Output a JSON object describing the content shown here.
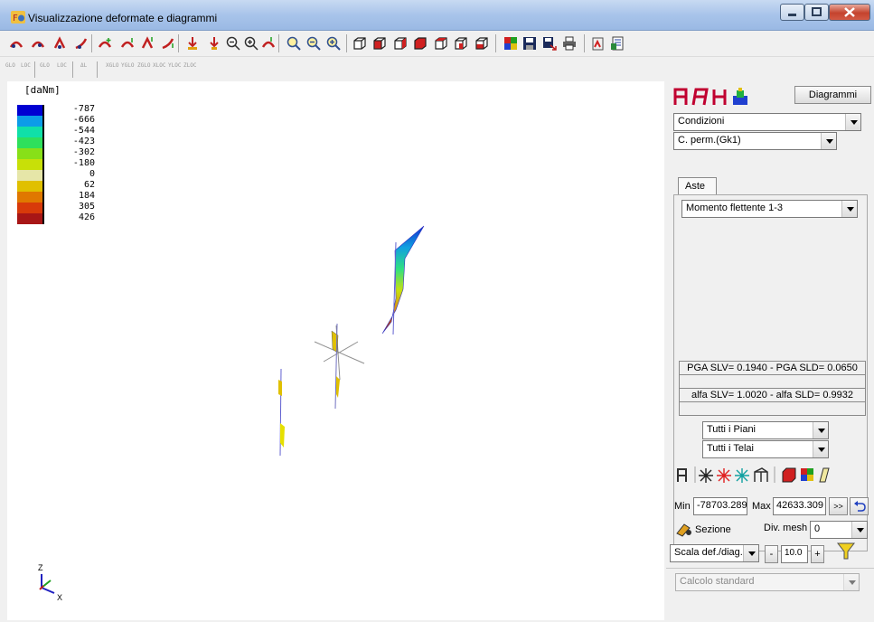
{
  "window": {
    "title": "Visualizzazione deformate e diagrammi",
    "minimize_icon": "minimize-icon",
    "maximize_icon": "maximize-icon",
    "close_icon": "close-icon"
  },
  "toolbar": {
    "groups": [
      "deform-view-icons",
      "deform-add-icons",
      "load-icons",
      "zoom-icons",
      "zoom-window-icons",
      "view-cube-icons",
      "color-map-icon",
      "save-icon",
      "export-icon",
      "print-icon",
      "copy-icon",
      "report-icon"
    ],
    "secondary_labels": [
      "GLO",
      "LOC",
      "GLO",
      "LOC",
      "ΔL",
      "XGLO",
      "YGLO",
      "ZGLO",
      "XLOC",
      "YLOC",
      "ZLOC"
    ]
  },
  "legend": {
    "unit": "[daNm]",
    "items": [
      {
        "value": "-787",
        "color": "#0000d2"
      },
      {
        "value": "-666",
        "color": "#0c9ce8"
      },
      {
        "value": "-544",
        "color": "#10e0a8"
      },
      {
        "value": "-423",
        "color": "#2ee05c"
      },
      {
        "value": "-302",
        "color": "#88e018"
      },
      {
        "value": "-180",
        "color": "#c8e008"
      },
      {
        "value": "0",
        "color": "#e6e6a8"
      },
      {
        "value": "62",
        "color": "#e0c000"
      },
      {
        "value": "184",
        "color": "#e07800"
      },
      {
        "value": "305",
        "color": "#d83a0a"
      },
      {
        "value": "426",
        "color": "#a81616"
      }
    ]
  },
  "panel": {
    "header_button": "Diagrammi",
    "condizioni": "Condizioni",
    "condition_value": "C. perm.(Gk1)",
    "tab_aste": "Aste",
    "diagram_type": "Momento flettente 1-3",
    "pga_line": "PGA SLV= 0.1940 - PGA SLD= 0.0650",
    "alfa_line": "alfa SLV= 1.0020 - alfa SLD= 0.9932",
    "piani": "Tutti i Piani",
    "telai": "Tutti i Telai",
    "min_label": "Min",
    "min_value": "-78703.289",
    "max_label": "Max",
    "max_value": "42633.309",
    "next_btn": ">>",
    "sezione": "Sezione",
    "div_mesh_label": "Div. mesh",
    "div_mesh_value": "0",
    "scala_label": "Scala def./diag.",
    "minus": "-",
    "scale_value": "10.0",
    "plus": "+",
    "calcolo": "Calcolo standard"
  },
  "axes": {
    "z": "Z",
    "x": "X"
  }
}
